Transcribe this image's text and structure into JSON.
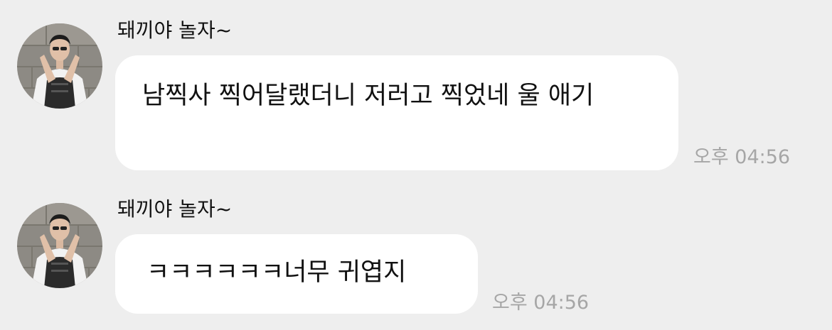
{
  "messages": [
    {
      "sender": "돼끼야 놀자~",
      "text": "남찍사 찍어달랬더니 저러고 찍었네 울 애기",
      "time": "오후 04:56"
    },
    {
      "sender": "돼끼야 놀자~",
      "text": "ㅋㅋㅋㅋㅋㅋ너무 귀엽지",
      "time": "오후 04:56"
    }
  ],
  "colors": {
    "background": "#eeeeee",
    "bubble": "#ffffff",
    "timestamp": "#a6a6a6"
  }
}
